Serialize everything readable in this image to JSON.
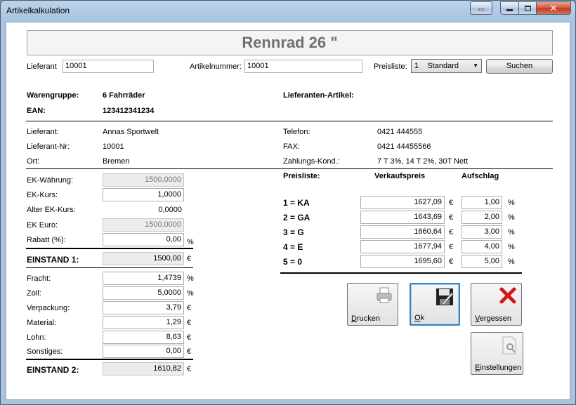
{
  "window": {
    "title": "Artikelkalkulation",
    "ghost_text": "..."
  },
  "header": {
    "title": "Rennrad 26 \""
  },
  "search": {
    "lieferant_label": "Lieferant",
    "lieferant_value": "10001",
    "artikelnummer_label": "Artikelnummer:",
    "artikelnummer_value": "10001",
    "preisliste_label": "Preisliste:",
    "preisliste_value": "1    Standard",
    "suchen_label": "Suchen"
  },
  "article": {
    "warengruppe_label": "Warengruppe:",
    "warengruppe_value": "6 Fahrräder",
    "ean_label": "EAN:",
    "ean_value": "123412341234",
    "lieferanten_artikel_label": "Lieferanten-Artikel:"
  },
  "supplier": {
    "lieferant_label": "Lieferant:",
    "lieferant_value": "Annas Sportwelt",
    "nr_label": "Lieferant-Nr:",
    "nr_value": "10001",
    "ort_label": "Ort:",
    "ort_value": "Bremen",
    "telefon_label": "Telefon:",
    "telefon_value": "0421 444555",
    "fax_label": "FAX:",
    "fax_value": "0421 44455566",
    "zahlung_label": "Zahlungs-Kond.:",
    "zahlung_value": "7 T 3%, 14 T 2%, 30T Nett"
  },
  "calc": {
    "ek_waehrung_label": "EK-Währung:",
    "ek_waehrung_value": "1500,0000",
    "ek_kurs_label": "EK-Kurs:",
    "ek_kurs_value": "1,0000",
    "alter_kurs_label": "Alter EK-Kurs:",
    "alter_kurs_value": "0,0000",
    "ek_euro_label": "EK Euro:",
    "ek_euro_value": "1500,0000",
    "rabatt_label": "Rabatt (%):",
    "rabatt_value": "0,00",
    "einstand1_label": "EINSTAND 1:",
    "einstand1_value": "1500,00",
    "fracht_label": "Fracht:",
    "fracht_value": "1,4739",
    "zoll_label": "Zoll:",
    "zoll_value": "5,0000",
    "verpackung_label": "Verpackung:",
    "verpackung_value": "3,79",
    "material_label": "Material:",
    "material_value": "1,29",
    "lohn_label": "Lohn:",
    "lohn_value": "8,63",
    "sonstiges_label": "Sonstiges:",
    "sonstiges_value": "0,00",
    "einstand2_label": "EINSTAND 2:",
    "einstand2_value": "1610,82",
    "percent": "%",
    "euro": "€"
  },
  "prices": {
    "col_preisliste": "Preisliste:",
    "col_verkaufspreis": "Verkaufspreis",
    "col_aufschlag": "Aufschlag",
    "rows": [
      {
        "label": "1 = KA",
        "price": "1627,09",
        "markup": "1,00"
      },
      {
        "label": "2 = GA",
        "price": "1643,69",
        "markup": "2,00"
      },
      {
        "label": "3 = G",
        "price": "1660,64",
        "markup": "3,00"
      },
      {
        "label": "4 = E",
        "price": "1677,94",
        "markup": "4,00"
      },
      {
        "label": "5 = 0",
        "price": "1695,60",
        "markup": "5,00"
      }
    ]
  },
  "actions": {
    "drucken": {
      "u": "D",
      "rest": "rucken"
    },
    "ok": {
      "u": "O",
      "rest": "k"
    },
    "vergessen": {
      "u": "V",
      "rest": "ergessen"
    },
    "einstellungen": {
      "u": "E",
      "rest": "instellungen"
    }
  },
  "colors": {
    "close_red": "#c2391a",
    "cancel_x": "#d0181e",
    "focus_blue": "#3c7fb1"
  }
}
